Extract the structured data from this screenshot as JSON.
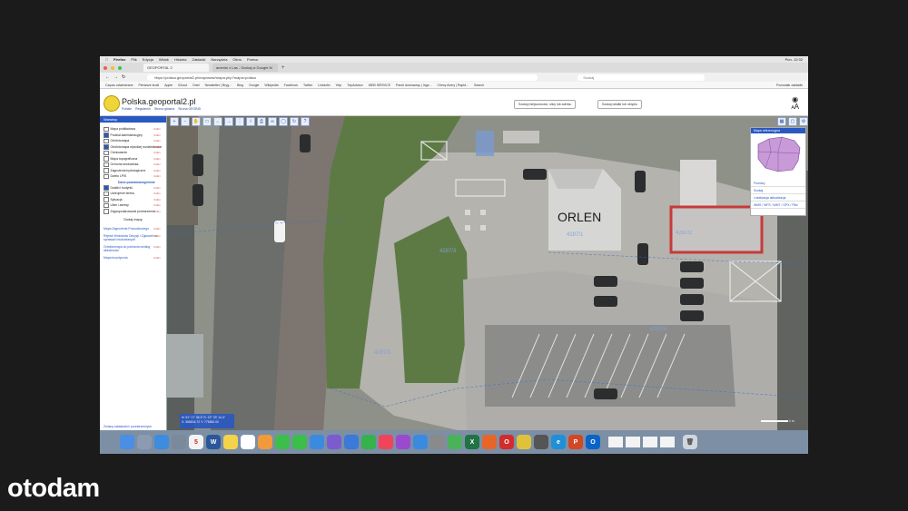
{
  "menubar": {
    "items": [
      "Firefox",
      "Plik",
      "Edycja",
      "Widok",
      "Historia",
      "Zakładki",
      "Narzędzia",
      "Okno",
      "Pomoc"
    ],
    "clock": "Pon. 12:32"
  },
  "tabs": [
    {
      "label": "GEOPORTAL 2"
    },
    {
      "label": "amerini z Las - Szukaj w Google M"
    }
  ],
  "url": "https://polska.geoportal2.pl/map/www/mapa.php?mapa=polska",
  "search_placeholder": "Szukaj",
  "bookmarks": {
    "items": [
      "Często odwiedzane",
      "Pierwsze kroki",
      "Apple",
      "iCloud",
      "Onet",
      "Newsletter | Bryg...",
      "Bing",
      "Google",
      "Wikipedia",
      "Facebook",
      "Twitter",
      "LinkedIn",
      "Yelp",
      "TripAdvisor",
      "WEB SERVICE",
      "Panel dumnaowy | Inge...",
      "Chexy Avery | Rapid...",
      "Search"
    ],
    "other": "Pozostałe zakładki"
  },
  "site": {
    "title": "Polska.geoportal2.pl",
    "links": [
      "Portale",
      "Regulamin",
      "Strona główna",
      "Strona GEOBID"
    ],
    "search_address": "Szukaj miejscowości, ulicy lub adresu",
    "search_parcel": "Szukaj działki lub obrębu",
    "size_label": "A"
  },
  "sidebar": {
    "header": "Warstwy",
    "layers": [
      {
        "label": "Mapa podkładowa",
        "checked": false
      },
      {
        "label": "Podział administracyjny",
        "checked": true
      },
      {
        "label": "Ortofotomapa",
        "checked": false
      },
      {
        "label": "Ortofotomapa wysokiej rozdzielczości",
        "checked": true
      },
      {
        "label": "Cieniowanie",
        "checked": false
      },
      {
        "label": "Mapa topograficzna",
        "checked": false
      },
      {
        "label": "Ochrona środowiska",
        "checked": false
      },
      {
        "label": "Zagrożenia hydrologiczne",
        "checked": false
      },
      {
        "label": "Dzieło LPIS",
        "checked": false
      }
    ],
    "group": "Dane powiatowe/gminne",
    "group_layers": [
      {
        "label": "Działki i budynki",
        "checked": true
      },
      {
        "label": "Uzbrojenie terenu",
        "checked": false
      },
      {
        "label": "Sytuacja",
        "checked": false
      },
      {
        "label": "Ulice i adresy",
        "checked": false
      },
      {
        "label": "Zagospodarowanie przestrzenne",
        "checked": false
      }
    ],
    "info_label": "<info>",
    "add_map": "Dodaj mapę",
    "extras": [
      {
        "label": "Mapa Zagrożenia Powodziowego"
      },
      {
        "label": "Rejestr Wniosków Decyzji i Zgłoszeń w sprawach budowlanych"
      },
      {
        "label": "Ortofotomapa do pobrania według aktualności"
      },
      {
        "label": "Mapa turystyczna"
      }
    ],
    "footer": "Zmiany katastralni i przestrzennych"
  },
  "map": {
    "station_label": "ORLEN",
    "parcels": [
      "4287/1",
      "4287/3",
      "4287/4",
      "4287/2",
      "4287/3"
    ]
  },
  "right_panel": {
    "header": "Mapa referencyjna",
    "items": [
      "Pomiary",
      "Szukaj",
      "Lokalizacja aktualizacja",
      "WMS / WFS / WMT / GPX / Pliki"
    ]
  },
  "coords": {
    "lat": "N: 51° 17' 36.3\"",
    "lon": "E: 22° 33' 14.4\"",
    "x": "X: 368834.72",
    "y": "Y: 776881.00"
  },
  "scale": "1 m",
  "dock": [
    {
      "name": "finder",
      "label": "",
      "color": "#4a8ee6"
    },
    {
      "name": "launchpad",
      "label": "",
      "color": "#8a9bb3"
    },
    {
      "name": "safari",
      "label": "",
      "color": "#3c8ce0"
    },
    {
      "name": "preview",
      "label": "",
      "color": "#7a8a9a"
    },
    {
      "name": "calendar",
      "label": "5",
      "color": "#f3f3f3"
    },
    {
      "name": "word",
      "label": "W",
      "color": "#2b579a"
    },
    {
      "name": "notes",
      "label": "",
      "color": "#f2d34a"
    },
    {
      "name": "reminders",
      "label": "",
      "color": "#ffffff"
    },
    {
      "name": "photos",
      "label": "",
      "color": "#f09a3a"
    },
    {
      "name": "facetime",
      "label": "",
      "color": "#3bbf4a"
    },
    {
      "name": "messages",
      "label": "",
      "color": "#3bbf4a"
    },
    {
      "name": "mail",
      "label": "",
      "color": "#3a8be0"
    },
    {
      "name": "siri",
      "label": "",
      "color": "#7a5cd0"
    },
    {
      "name": "keynote",
      "label": "",
      "color": "#3a7ad8"
    },
    {
      "name": "numbers",
      "label": "",
      "color": "#35b24a"
    },
    {
      "name": "music",
      "label": "",
      "color": "#f0445a"
    },
    {
      "name": "podcasts",
      "label": "",
      "color": "#9b4ad0"
    },
    {
      "name": "appstore",
      "label": "",
      "color": "#3a8be0"
    },
    {
      "name": "settings",
      "label": "",
      "color": "#8a8a8a"
    },
    {
      "name": "maps",
      "label": "",
      "color": "#4ab35a"
    },
    {
      "name": "excel",
      "label": "X",
      "color": "#217346"
    },
    {
      "name": "firefox",
      "label": "",
      "color": "#e8652a"
    },
    {
      "name": "opera",
      "label": "O",
      "color": "#d22c2c"
    },
    {
      "name": "chrome",
      "label": "",
      "color": "#e0c23a"
    },
    {
      "name": "safari2",
      "label": "",
      "color": "#555555"
    },
    {
      "name": "edge",
      "label": "e",
      "color": "#1f8fd8"
    },
    {
      "name": "powerpoint",
      "label": "P",
      "color": "#d24726"
    },
    {
      "name": "outlook",
      "label": "O",
      "color": "#0a64c8"
    }
  ],
  "watermark": "otodam"
}
